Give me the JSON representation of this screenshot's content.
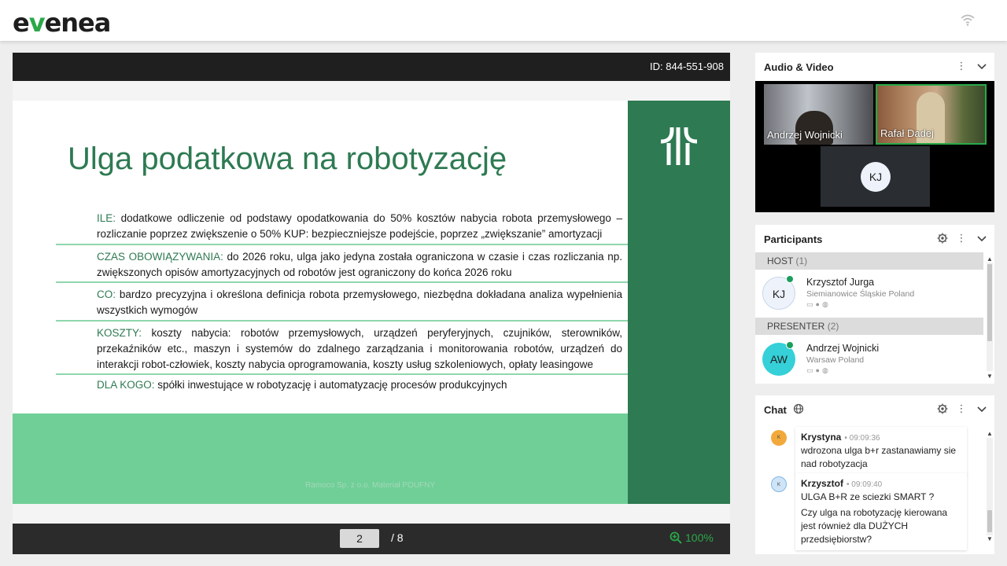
{
  "app": {
    "logo_prefix": "e",
    "logo_v": "v",
    "logo_suffix": "enea"
  },
  "presentation": {
    "id_label": "ID: 844-551-908",
    "current_page": "2",
    "total_pages": "/ 8",
    "zoom": "100%"
  },
  "slide": {
    "title": "Ulga podatkowa na robotyzację",
    "bullets": [
      {
        "key": "ILE:",
        "text": " dodatkowe odliczenie od podstawy opodatkowania do 50% kosztów nabycia robota przemysłowego – rozliczanie poprzez zwiększenie o 50% KUP: bezpieczniejsze podejście, poprzez „zwiększanie” amortyzacji"
      },
      {
        "key": "CZAS OBOWIĄZYWANIA:",
        "text": " do 2026 roku, ulga jako jedyna została ograniczona w czasie i czas rozliczania np. zwiększonych opisów amortyzacyjnych od robotów jest ograniczony do końca 2026 roku"
      },
      {
        "key": "CO:",
        "text": " bardzo precyzyjna i określona definicja robota przemysłowego, niezbędna dokładana analiza wypełnienia wszystkich wymogów"
      },
      {
        "key": "KOSZTY:",
        "text": " koszty nabycia: robotów przemysłowych, urządzeń peryferyjnych, czujników, sterowników, przekaźników etc., maszyn i systemów do zdalnego zarządzania i monitorowania robotów, urządzeń do interakcji robot-człowiek, koszty nabycia oprogramowania, koszty usług szkoleniowych, opłaty leasingowe"
      },
      {
        "key": "DLA KOGO:",
        "text": " spółki inwestujące w robotyzację i automatyzację procesów produkcyjnych"
      }
    ],
    "footnote": "Ramoco Sp. z o.o. Materiał POUFNY"
  },
  "audio_video": {
    "title": "Audio & Video",
    "tiles": [
      {
        "name": "Andrzej Wojnicki"
      },
      {
        "name": "Rafał Dadej"
      }
    ],
    "placeholder_initials": "KJ"
  },
  "participants": {
    "title": "Participants",
    "groups": [
      {
        "label": "HOST",
        "count": "(1)",
        "members": [
          {
            "initials": "KJ",
            "name": "Krzysztof Jurga",
            "location": "Siemianowice Śląskie Poland",
            "avatar_color": "#eef3fb"
          }
        ]
      },
      {
        "label": "PRESENTER",
        "count": "(2)",
        "members": [
          {
            "initials": "AW",
            "name": "Andrzej Wojnicki",
            "location": "Warsaw Poland",
            "avatar_color": "#35d0d8"
          }
        ]
      }
    ]
  },
  "chat": {
    "title": "Chat",
    "messages": [
      {
        "initial": "K",
        "author": "Krystyna",
        "time": "• 09:09:36",
        "lines": [
          "wdrozona ulga b+r zastanawiamy sie nad robotyzacja"
        ],
        "avatar_color": "#f2a93b"
      },
      {
        "initial": "K",
        "author": "Krzysztof",
        "time": "• 09:09:40",
        "lines": [
          "ULGA B+R ze sciezki SMART ?",
          "Czy ulga na robotyzację kierowana jest również dla DUŻYCH przedsiębiorstw?"
        ],
        "avatar_color": "#7fb8e6"
      }
    ]
  },
  "colors": {
    "brand_green": "#2aa84a",
    "slide_dark_green": "#2e7a52",
    "slide_light_green": "#6fcf97"
  }
}
